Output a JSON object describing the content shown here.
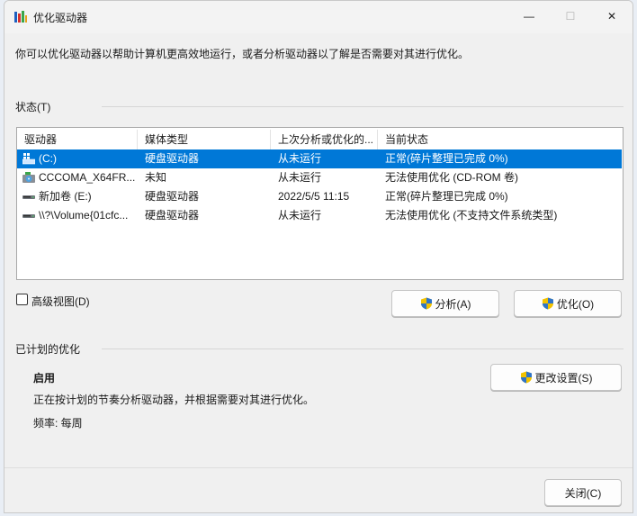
{
  "window": {
    "title": "优化驱动器",
    "min_glyph": "—",
    "max_glyph": "☐",
    "close_glyph": "✕"
  },
  "intro_text": "你可以优化驱动器以帮助计算机更高效地运行，或者分析驱动器以了解是否需要对其进行优化。",
  "status_section": {
    "label": "状态(T)"
  },
  "drives_table": {
    "columns": [
      "驱动器",
      "媒体类型",
      "上次分析或优化的...",
      "当前状态"
    ],
    "rows": [
      {
        "icon": "system-drive-icon",
        "drive": "(C:)",
        "media": "硬盘驱动器",
        "last_run": "从未运行",
        "status": "正常(碎片整理已完成 0%)",
        "selected": true
      },
      {
        "icon": "cdrom-drive-icon",
        "drive": "CCCOMA_X64FR...",
        "media": "未知",
        "last_run": "从未运行",
        "status": "无法使用优化 (CD-ROM 卷)",
        "selected": false
      },
      {
        "icon": "hard-drive-icon",
        "drive": "新加卷 (E:)",
        "media": "硬盘驱动器",
        "last_run": "2022/5/5 11:15",
        "status": "正常(碎片整理已完成 0%)",
        "selected": false
      },
      {
        "icon": "hard-drive-icon",
        "drive": "\\\\?\\Volume{01cfc...",
        "media": "硬盘驱动器",
        "last_run": "从未运行",
        "status": "无法使用优化 (不支持文件系统类型)",
        "selected": false
      }
    ]
  },
  "advanced_view": {
    "label": "高级视图(D)",
    "checked": false
  },
  "buttons": {
    "analyze": "分析(A)",
    "optimize": "优化(O)",
    "change_settings": "更改设置(S)",
    "close": "关闭(C)"
  },
  "scheduled": {
    "section_label": "已计划的优化",
    "state": "启用",
    "description": "正在按计划的节奏分析驱动器，并根据需要对其进行优化。",
    "frequency": "频率: 每周"
  },
  "colors": {
    "selection": "#0078d7",
    "window_bg": "#f0f0f0",
    "shield_blue": "#2f74c8",
    "shield_yellow": "#f2c200"
  }
}
